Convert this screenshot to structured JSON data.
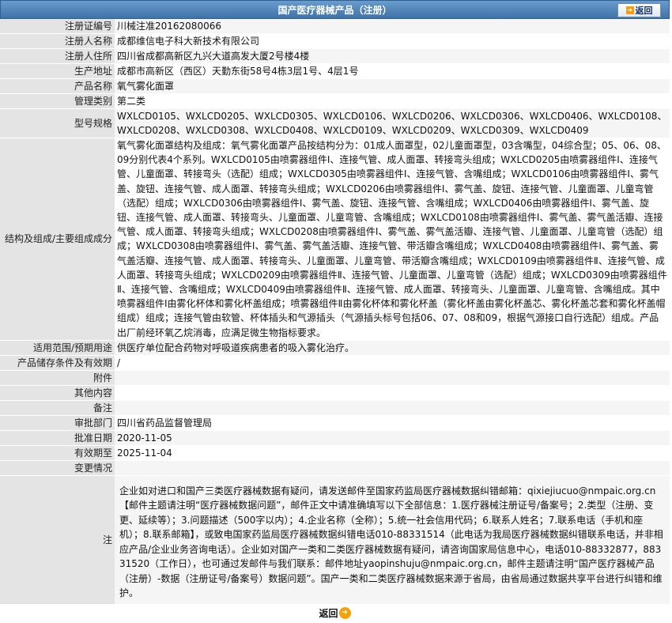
{
  "header": {
    "title": "国产医疗器械产品（注册）",
    "back_label": "返回",
    "back_icon": "arrow-right-icon"
  },
  "rows": [
    {
      "label": "注册证编号",
      "value": "川械注准20162080066"
    },
    {
      "label": "注册人名称",
      "value": "成都维信电子科大新技术有限公司"
    },
    {
      "label": "注册人住所",
      "value": "四川省成都高新区九兴大道高发大厦2号楼4楼"
    },
    {
      "label": "生产地址",
      "value": "成都市高新区（西区）天勤东街58号4栋3层1号、4层1号"
    },
    {
      "label": "产品名称",
      "value": "氧气雾化面罩"
    },
    {
      "label": "管理类别",
      "value": "第二类"
    },
    {
      "label": "型号规格",
      "value": "WXLCD0105、WXLCD0205、WXLCD0305、WXLCD0106、WXLCD0206、WXLCD0306、WXLCD0406、WXLCD0108、WXLCD0208、WXLCD0308、WXLCD0408、WXLCD0109、WXLCD0209、WXLCD0309、WXLCD0409"
    },
    {
      "label": "结构及组成/主要组成成分",
      "value": "氧气雾化面罩结构及组成：氧气雾化面罩产品按结构分为：01成人面罩型，02儿童面罩型，03含嘴型，04综合型；05、06、08、09分别代表4个系列。WXLCD0105由喷雾器组件Ⅰ、连接气管、成人面罩、转接弯头组成；WXLCD0205由喷雾器组件Ⅰ、连接气管、儿童面罩、转接弯头（选配）组成；WXLCD0305由喷雾器组件Ⅰ、连接气管、含嘴组成；WXLCD0106由喷雾器组件Ⅰ、雾气盖、旋钮、连接气管、成人面罩、转接弯头组成；WXLCD0206由喷雾器组件Ⅰ、雾气盖、旋钮、连接气管、儿童面罩、儿童弯管（选配）组成；WXLCD0306由喷雾器组件Ⅰ、雾气盖、旋钮、连接气管、含嘴组成；WXLCD0406由喷雾器组件Ⅰ、雾气盖、旋钮、连接气管、成人面罩、转接弯头、儿童面罩、儿童弯管、含嘴组成；WXLCD0108由喷雾器组件Ⅰ、雾气盖、雾气盖活瓣、连接气管、成人面罩、转接弯头组成；WXLCD0208由喷雾器组件Ⅰ、雾气盖、雾气盖活瓣、连接气管、儿童面罩、儿童弯管（选配）组成；WXLCD0308由喷雾器组件Ⅰ、雾气盖、雾气盖活瓣、连接气管、带活瓣含嘴组成；WXLCD0408由喷雾器组件Ⅰ、雾气盖、雾气盖活瓣、连接气管、成人面罩、转接弯头、儿童面罩、儿童弯管、带活瓣含嘴组成；WXLCD0109由喷雾器组件Ⅱ、连接气管、成人面罩、转接弯头组成；WXLCD0209由喷雾器组件Ⅱ、连接气管、儿童面罩、儿童弯管（选配）组成；WXLCD0309由喷雾器组件Ⅱ、连接气管、含嘴组成；WXLCD0409由喷雾器组件Ⅱ、连接气管、成人面罩、转接弯头、儿童面罩、儿童弯管、含嘴组成。其中喷雾器组件Ⅰ由雾化杯体和雾化杯盖组成；喷雾器组件Ⅱ由雾化杯体和雾化杯盖（雾化杯盖由雾化杯盖芯、雾化杯盖芯套和雾化杯盖帽组成）组成；连接气管由软管、杯体插头和气源插头（气源插头标号包括06、07、08和09，根据气源接口自行选配）组成。产品出厂前经环氧乙烷消毒，应满足微生物指标要求。",
      "long": true
    },
    {
      "label": "适用范围/预期用途",
      "value": "供医疗单位配合药物对呼吸道疾病患者的吸入雾化治疗。"
    },
    {
      "label": "产品储存条件及有效期",
      "value": "/"
    },
    {
      "label": "附件",
      "value": ""
    },
    {
      "label": "其他内容",
      "value": ""
    },
    {
      "label": "备注",
      "value": ""
    },
    {
      "label": "审批部门",
      "value": "四川省药品监督管理局"
    },
    {
      "label": "批准日期",
      "value": "2020-11-05"
    },
    {
      "label": "有效期至",
      "value": "2025-11-04"
    },
    {
      "label": "变更情况",
      "value": ""
    }
  ],
  "note": {
    "label": "注",
    "text": "企业如对进口和国产三类医疗器械数据有疑问，请发送邮件至国家药监局医疗器械数据纠错邮箱：qixiejiucuo@nmpaic.org.cn【邮件主题请注明“医疗器械数据问题”，邮件正文中请准确填写以下全部信息：1.医疗器械注册证号/备案号；2.类型（注册、变更、延续等）；3.问题描述（500字以内）；4.企业名称（全称）；5.统一社会信用代码；6.联系人姓名；7.联系电话（手机和座机）；8.联系邮箱】，或致电国家药监局医疗器械数据纠错电话010-88331514（此电话为我局医疗器械数据纠错联系电话，并非相应产品/企业业务咨询电话）。企业如对国产一类和二类医疗器械数据有疑问，请咨询国家局信息中心，电话010-88332877，88331520（工作日），也可通过发邮件与我们联系：邮件地址yaopinshuju@nmpaic.org.cn，邮件主题请注明“国产医疗器械产品（注册）-数据（注册证号/备案号）数据问题”。国产一类和二类医疗器械数据来源于省局，由省局通过数据共享平台进行纠错和维护。"
  },
  "footer": {
    "back_label": "返回",
    "back_icon": "arrow-right-circle-icon"
  }
}
